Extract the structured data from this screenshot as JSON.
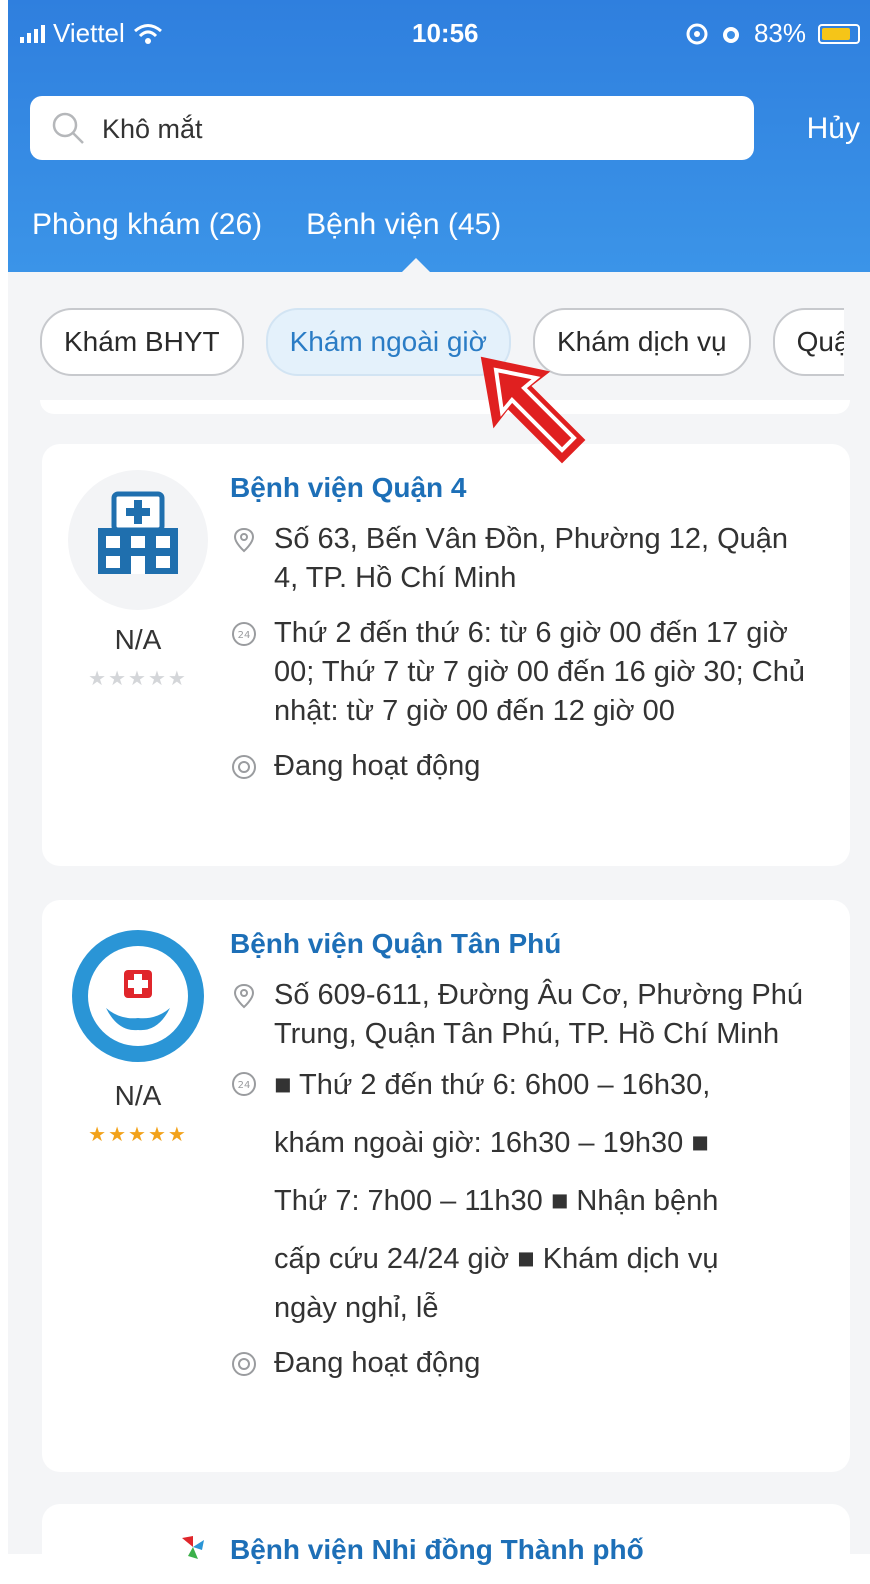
{
  "status_bar": {
    "carrier": "Viettel",
    "time": "10:56",
    "battery": "83%",
    "battery_level": 0.83
  },
  "search": {
    "value": "Khô mắt",
    "placeholder": ""
  },
  "cancel_label": "Hủy",
  "tabs": [
    {
      "label": "Phòng khám (26)"
    },
    {
      "label": "Bệnh viện (45)"
    }
  ],
  "filters": [
    {
      "label": "Khám BHYT"
    },
    {
      "label": "Khám ngoài giờ"
    },
    {
      "label": "Khám dịch vụ"
    },
    {
      "label": "Quận"
    }
  ],
  "hospitals": [
    {
      "name": "Bệnh viện Quận 4",
      "address": "Số 63, Bến Vân Đồn, Phường 12, Quận 4, TP. Hồ Chí Minh",
      "hours": "Thứ 2 đến thứ 6: từ 6 giờ 00 đến 17 giờ 00; Thứ 7 từ 7 giờ 00 đến 16 giờ 30; Chủ nhật: từ 7 giờ 00 đến 12 giờ 00",
      "status": "Đang hoạt động",
      "rating": "N/A",
      "stars": "★★★★★"
    },
    {
      "name": "Bệnh viện Quận Tân Phú",
      "address": "Số 609-611, Đường Âu Cơ, Phường Phú Trung, Quận Tân Phú, TP. Hồ Chí Minh",
      "hours_lines": [
        "■  Thứ 2 đến thứ 6: 6h00 – 16h30,",
        "khám ngoài giờ: 16h30 – 19h30  ■",
        "Thứ 7: 7h00 – 11h30  ■  Nhận bệnh",
        "cấp cứu 24/24 giờ  ■  Khám dịch vụ",
        "ngày nghỉ, lễ"
      ],
      "status": "Đang hoạt động",
      "rating": "N/A",
      "stars": "★★★★★"
    },
    {
      "name": "Bệnh viện Nhi đồng Thành phố"
    }
  ],
  "icons": {
    "search": "search-icon",
    "location": "location-pin-icon",
    "clock": "clock-24-icon",
    "status": "status-dot-icon",
    "arrow": "red-arrow-annotation"
  },
  "colors": {
    "header": "#2f7fde",
    "accent": "#1d6fb7",
    "star_gold": "#f2a21a",
    "arrow": "#e02020"
  }
}
